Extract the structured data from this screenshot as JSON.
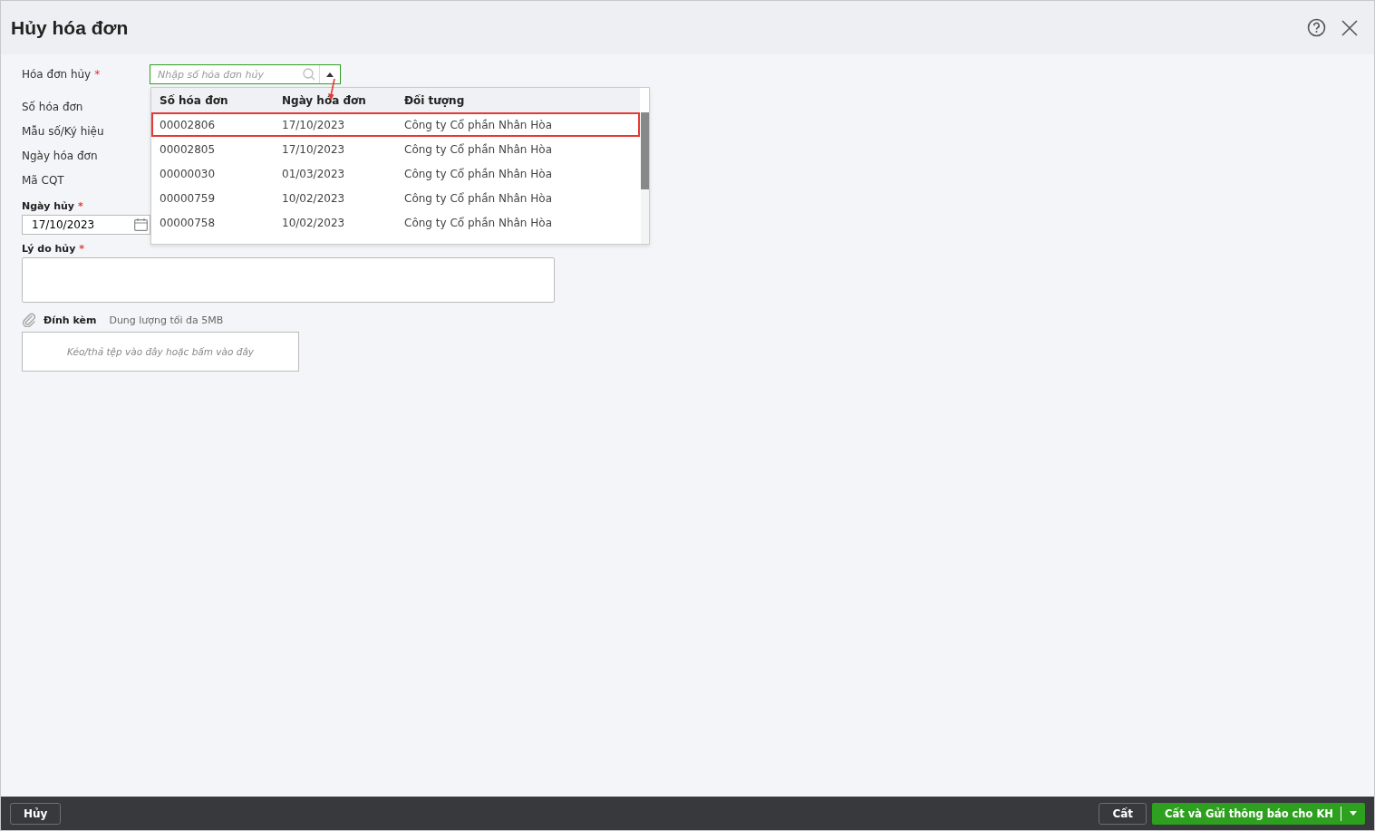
{
  "window": {
    "title": "Hủy hóa đơn"
  },
  "form": {
    "invoice_field": {
      "label": "Hóa đơn hủy",
      "required_mark": "*",
      "placeholder": "Nhập số hóa đơn hủy",
      "expanded": true
    },
    "info_labels": [
      "Số hóa đơn",
      "Mẫu số/Ký hiệu",
      "Ngày hóa đơn",
      "Mã CQT"
    ],
    "cancel_date": {
      "label": "Ngày hủy",
      "required_mark": "*",
      "value": "17/10/2023"
    },
    "reason": {
      "label": "Lý do hủy",
      "required_mark": "*"
    },
    "attachment": {
      "label": "Đính kèm",
      "note": "Dung lượng tối đa 5MB",
      "dropzone": "Kéo/thả tệp vào đây hoặc bấm vào đây"
    }
  },
  "dropdown": {
    "columns": [
      "Số hóa đơn",
      "Ngày hóa đơn",
      "Đối tượng"
    ],
    "rows": [
      {
        "cells": [
          "00002806",
          "17/10/2023",
          "Công ty Cổ phần Nhân Hòa"
        ],
        "selected": true
      },
      {
        "cells": [
          "00002805",
          "17/10/2023",
          "Công ty Cổ phần Nhân Hòa"
        ],
        "selected": false
      },
      {
        "cells": [
          "00000030",
          "01/03/2023",
          "Công ty Cổ phần Nhân Hòa"
        ],
        "selected": false
      },
      {
        "cells": [
          "00000759",
          "10/02/2023",
          "Công ty Cổ phần Nhân Hòa"
        ],
        "selected": false
      },
      {
        "cells": [
          "00000758",
          "10/02/2023",
          "Công ty Cổ phần Nhân Hòa"
        ],
        "selected": false
      }
    ]
  },
  "footer": {
    "cancel": "Hủy",
    "save": "Cất",
    "primary": "Cất và Gửi thông báo cho KH"
  }
}
